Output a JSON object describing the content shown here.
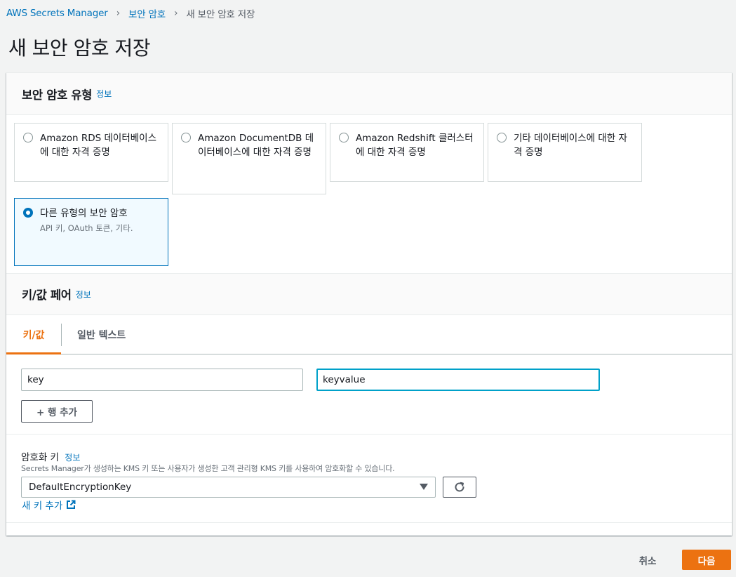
{
  "breadcrumb": {
    "items": [
      "AWS Secrets Manager",
      "보안 암호"
    ],
    "current": "새 보안 암호 저장"
  },
  "page_title": "새 보안 암호 저장",
  "secret_type": {
    "title": "보안 암호 유형",
    "info": "정보",
    "options": [
      {
        "label": "Amazon RDS 데이터베이스에 대한 자격 증명",
        "selected": false
      },
      {
        "label": "Amazon DocumentDB 데이터베이스에 대한 자격 증명",
        "selected": false
      },
      {
        "label": "Amazon Redshift 클러스터에 대한 자격 증명",
        "selected": false
      },
      {
        "label": "기타 데이터베이스에 대한 자격 증명",
        "selected": false
      },
      {
        "label": "다른 유형의 보안 암호",
        "description": "API 키, OAuth 토큰, 기타.",
        "selected": true
      }
    ]
  },
  "kv_pairs": {
    "title": "키/값 페어",
    "info": "정보",
    "tabs": [
      {
        "label": "키/값",
        "active": true
      },
      {
        "label": "일반 텍스트",
        "active": false
      }
    ],
    "row": {
      "key": "key",
      "value": "keyvalue"
    },
    "add_row_label": "+ 행 추가"
  },
  "encryption": {
    "label": "암호화 키",
    "info": "정보",
    "description": "Secrets Manager가 생성하는 KMS 키 또는 사용자가 생성한 고객 관리형 KMS 키를 사용하여 암호화할 수 있습니다.",
    "selected": "DefaultEncryptionKey",
    "new_key_link": "새 키 추가"
  },
  "footer": {
    "cancel_label": "취소",
    "next_label": "다음"
  },
  "colors": {
    "link": "#0073bb",
    "accent": "#ec7211",
    "selected_bg": "#f1faff"
  }
}
